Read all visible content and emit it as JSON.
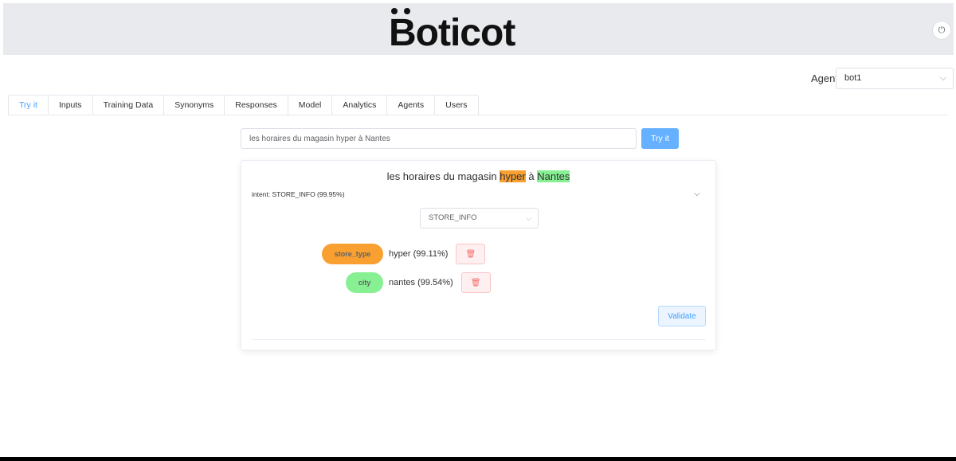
{
  "header": {
    "logo_text": "Boticot",
    "power_icon": "power-icon"
  },
  "agent": {
    "label": "Agent:",
    "selected": "bot1"
  },
  "tabs": [
    {
      "label": "Try it",
      "active": true
    },
    {
      "label": "Inputs"
    },
    {
      "label": "Training Data"
    },
    {
      "label": "Synonyms"
    },
    {
      "label": "Responses"
    },
    {
      "label": "Model"
    },
    {
      "label": "Analytics"
    },
    {
      "label": "Agents"
    },
    {
      "label": "Users"
    }
  ],
  "query": {
    "value": "les horaires du magasin hyper à Nantes",
    "button_label": "Try it"
  },
  "result": {
    "sentence_pre": "les horaires du magasin ",
    "entity1_text": "hyper",
    "sentence_mid": " à ",
    "entity2_text": "Nantes",
    "intent_line": "intent: STORE_INFO (99.95%)",
    "intent_selected": "STORE_INFO",
    "entities": [
      {
        "name": "store_type",
        "value": "hyper (99.11%)",
        "color": "#f9a030"
      },
      {
        "name": "city",
        "value": "nantes (99.54%)",
        "color": "#87f092"
      }
    ],
    "validate_label": "Validate"
  },
  "colors": {
    "accent": "#409eff",
    "store_type": "#f9a030",
    "city": "#87f092"
  }
}
